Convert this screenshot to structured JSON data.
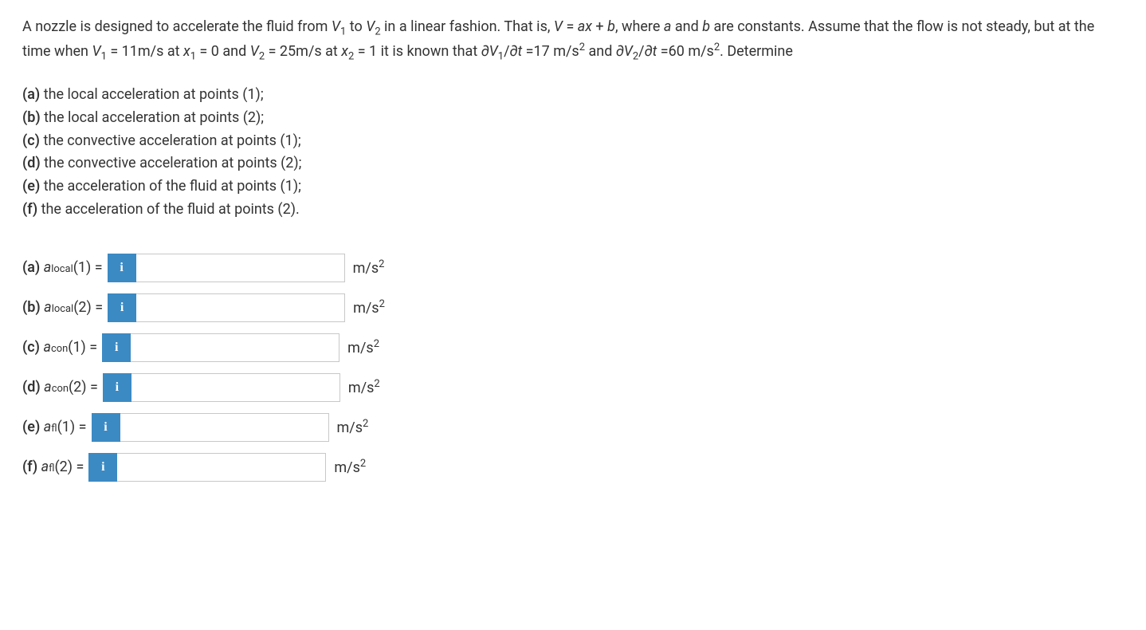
{
  "problem": {
    "main_text": "A nozzle is designed to accelerate the fluid from V₁ to V₂ in a linear fashion. That is, V = ax + b, where a and b are constants. Assume that the flow is not steady, but at the time when V₁ = 11m/s at x₁ = 0 and V₂ = 25m/s at x₂ = 1 it is known that ∂V₁/∂t =17 m/s² and ∂V₂/∂t =60 m/s². Determine",
    "parts": {
      "a": "the local acceleration at points (1);",
      "b": "the local acceleration at points (2);",
      "c": "the convective acceleration at points (1);",
      "d": "the convective acceleration at points (2);",
      "e": "the acceleration of the fluid at points (1);",
      "f": "the acceleration of the fluid at points (2)."
    }
  },
  "answers": {
    "a": {
      "prefix": "(a) ",
      "sym": "a",
      "sub": "local",
      "arg": "(1) = ",
      "unit": "m/s",
      "exp": "2",
      "value": ""
    },
    "b": {
      "prefix": "(b) ",
      "sym": "a",
      "sub": "local",
      "arg": "(2) = ",
      "unit": "m/s",
      "exp": "2",
      "value": ""
    },
    "c": {
      "prefix": "(c) ",
      "sym": "a",
      "sub": "con",
      "arg": "(1) = ",
      "unit": "m/s",
      "exp": "2",
      "value": ""
    },
    "d": {
      "prefix": "(d) ",
      "sym": "a",
      "sub": "con",
      "arg": "(2) = ",
      "unit": "m/s",
      "exp": "2",
      "value": ""
    },
    "e": {
      "prefix": "(e) ",
      "sym": "a",
      "sub": "fl",
      "arg": "(1) = ",
      "unit": "m/s",
      "exp": "2",
      "value": ""
    },
    "f": {
      "prefix": "(f) ",
      "sym": "a",
      "sub": "fl",
      "arg": "(2) = ",
      "unit": "m/s",
      "exp": "2",
      "value": ""
    }
  },
  "info_icon_label": "i"
}
